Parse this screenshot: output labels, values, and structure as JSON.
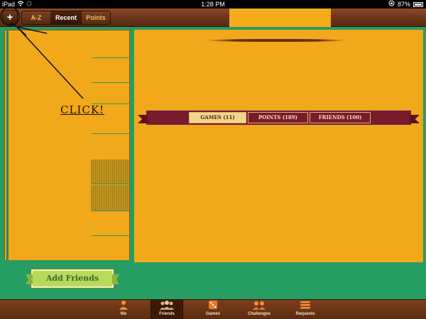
{
  "status_bar": {
    "device": "iPad",
    "time": "1:28 PM",
    "battery": "87%"
  },
  "toolbar": {
    "add_label": "+",
    "segments": [
      "A-Z",
      "Recent",
      "Points"
    ],
    "selected_segment": "Recent"
  },
  "annotation": {
    "text": "CLICK!"
  },
  "left_panel": {
    "add_friends_label": "Add Friends"
  },
  "main": {
    "tabs": [
      {
        "label": "GAMES (11)",
        "active": true
      },
      {
        "label": "POINTS (189)",
        "active": false
      },
      {
        "label": "FRIENDS (100)",
        "active": false
      }
    ]
  },
  "bottom_bar": {
    "items": [
      {
        "label": "Me",
        "icon": "person-icon"
      },
      {
        "label": "Friends",
        "icon": "friends-icon",
        "active": true
      },
      {
        "label": "Games",
        "icon": "dice-icon"
      },
      {
        "label": "Challenges",
        "icon": "challenges-icon"
      },
      {
        "label": "Requests",
        "icon": "list-icon"
      }
    ]
  },
  "colors": {
    "felt_green": "#259d63",
    "panel_orange": "#f2a81b",
    "wood": "#6b3417",
    "tab_maroon": "#7a1b2d"
  }
}
